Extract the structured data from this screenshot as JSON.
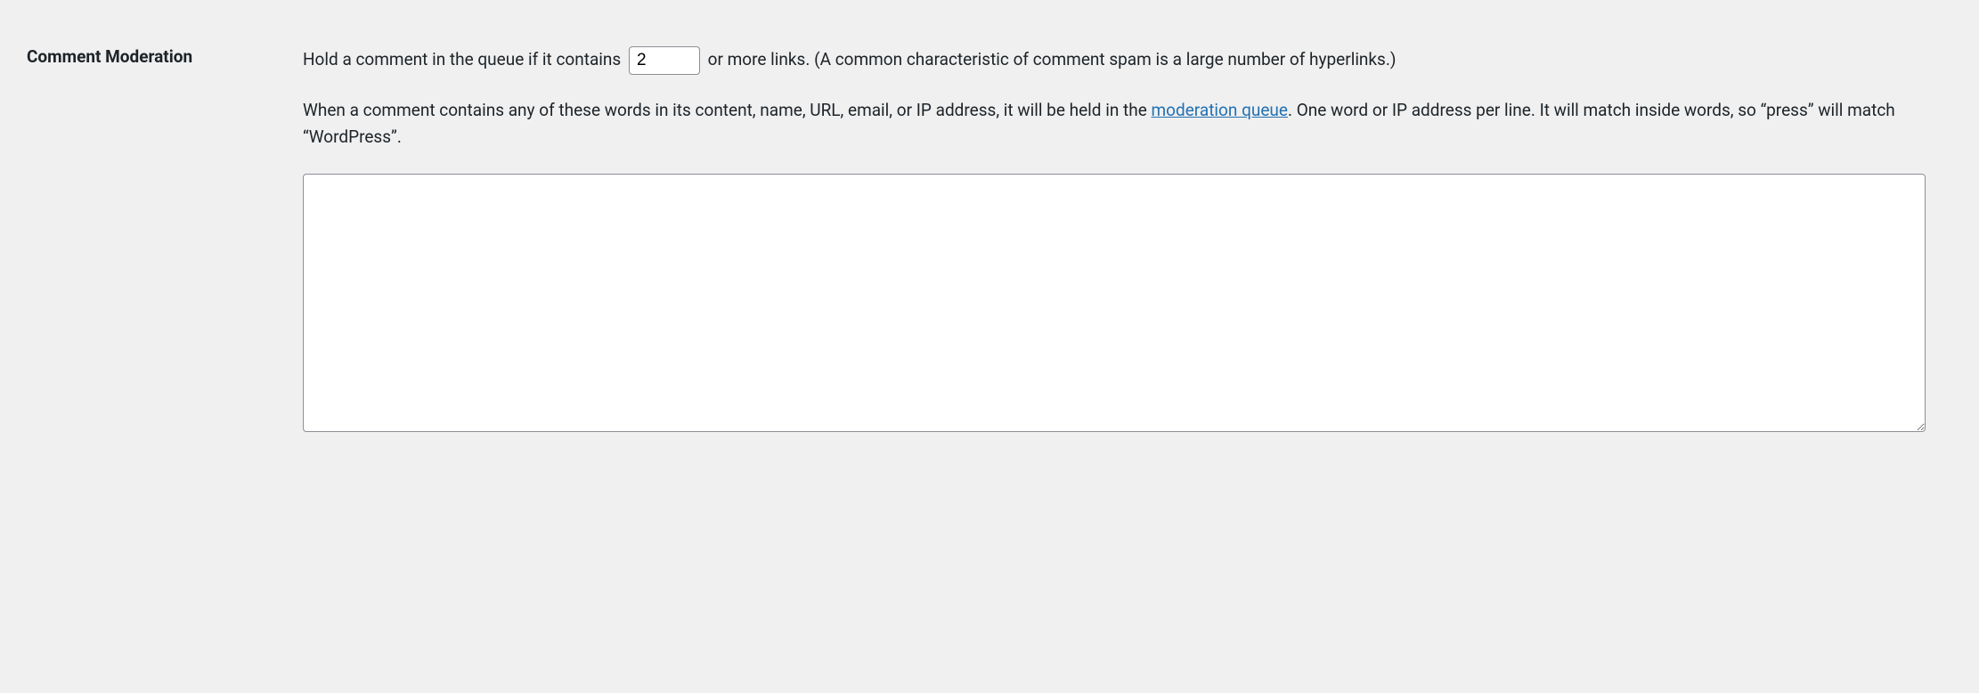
{
  "section": {
    "title": "Comment Moderation"
  },
  "links": {
    "text_before": "Hold a comment in the queue if it contains ",
    "count_value": "2",
    "text_after": " or more links. (A common characteristic of comment spam is a large number of hyperlinks.)"
  },
  "moderation": {
    "text_before_link": "When a comment contains any of these words in its content, name, URL, email, or IP address, it will be held in the ",
    "link_text": "moderation queue",
    "text_after_link": ". One word or IP address per line. It will match inside words, so “press” will match “WordPress”."
  },
  "textarea": {
    "value": ""
  }
}
